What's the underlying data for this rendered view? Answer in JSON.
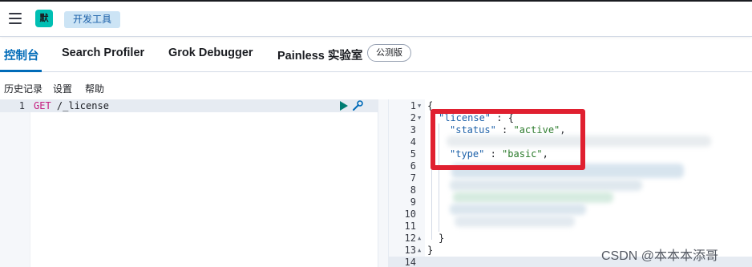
{
  "header": {
    "space_avatar": "默",
    "breadcrumb": "开发工具"
  },
  "tabs": [
    {
      "label": "控制台",
      "active": true
    },
    {
      "label": "Search Profiler",
      "active": false
    },
    {
      "label": "Grok Debugger",
      "active": false
    },
    {
      "label": "Painless 实验室",
      "active": false
    }
  ],
  "beta_badge": "公测版",
  "submenu": {
    "history": "历史记录",
    "settings": "设置",
    "help": "帮助"
  },
  "request_editor": {
    "lines": [
      {
        "number": "1",
        "method": "GET",
        "path": " /_license"
      }
    ]
  },
  "response_editor": {
    "line_numbers": [
      "1",
      "2",
      "3",
      "4",
      "5",
      "6",
      "7",
      "8",
      "9",
      "10",
      "11",
      "12",
      "13",
      "14"
    ],
    "open_brace": "{",
    "license_key": "\"license\"",
    "license_sep": " : {",
    "status_key": "\"status\"",
    "status_value": "\"active\"",
    "type_key": "\"type\"",
    "type_value": "\"basic\"",
    "colon": " : ",
    "comma": ",",
    "inner_close": "}",
    "outer_close": "}"
  },
  "watermark": "CSDN @本本本添哥",
  "colors": {
    "accent": "#006bb8",
    "highlight_box": "#e02030",
    "avatar_bg": "#00bfb3"
  },
  "icons": [
    "hamburger-menu-icon",
    "play-icon",
    "wrench-icon",
    "fold-arrow-icon"
  ]
}
